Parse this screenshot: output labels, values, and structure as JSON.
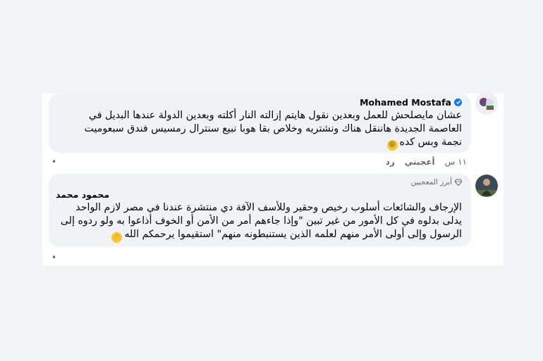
{
  "comments": [
    {
      "author": "Mohamed Mostafa",
      "verified": true,
      "text": "عشان مايصلحش للعمل وبعدين نقول هايتم إزالته النار أكلته وبعدين الدولة عندها البديل في\nالعاصمة الجديدة هاننقل هناك ونشتريه وخلاص بقا هوبا نبيع سنترال رمسيس فندق سبعوميت\nنجمة وبس كده",
      "emoji": "face-with-tongue-emoji",
      "time": "١١ س",
      "like_label": "أعجبني",
      "reply_label": "رد",
      "dot": "•"
    },
    {
      "badge": "أبرز المعجبين",
      "author": "محمود محمد",
      "text": "الإرجاف والشائعات أسلوب رخيص وحقير وللأسف الآفة دي منتشرة عندنا في مصر لازم الواحد\nيدلى بدلوه في كل الأمور من غير تبين \"وإذا جاءهم أمر من الأمن أو الخوف أذاعوا به ولو ردوه إلى\nالرسول وإلى أولى الأمر منهم لعلمه الذين يستنبطونه منهم\" استقيموا يرحمكم الله",
      "emoji": "ok-hand-emoji",
      "dot": "•"
    }
  ],
  "colors": {
    "page_bg": "#f3f4f8",
    "bubble_bg": "#f0f2f5",
    "verified": "#1877f2",
    "muted_text": "#65676b"
  }
}
